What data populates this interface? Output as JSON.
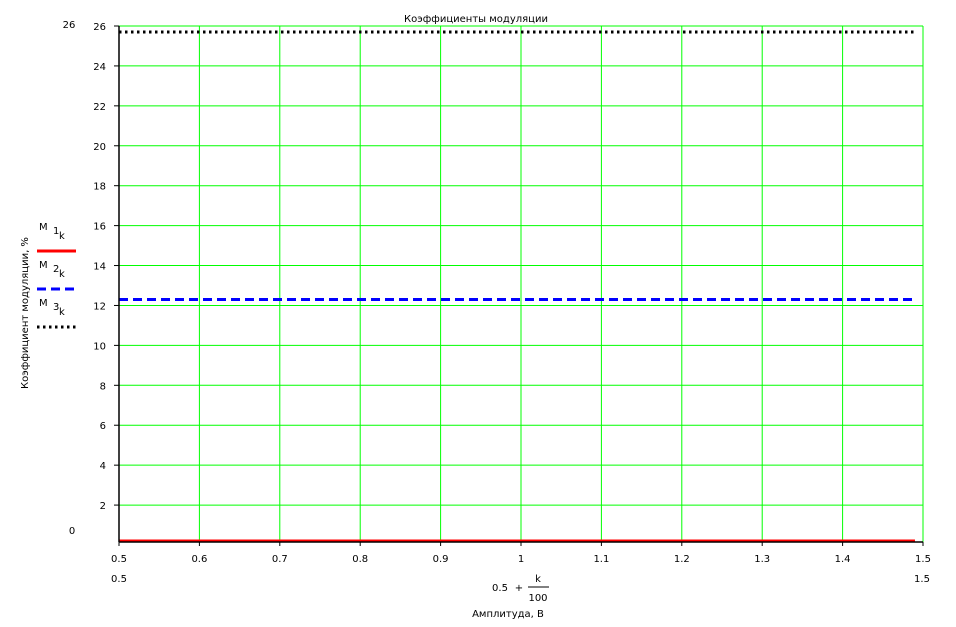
{
  "chart_data": {
    "type": "line",
    "title": "Коэффициенты модуляции",
    "xlabel": "Амплитуда, В",
    "x_expression": {
      "left": "0.5",
      "op": "+",
      "numerator": "k",
      "denominator": "100"
    },
    "ylabel": "Коэффициент модуляции, %",
    "xlim": [
      0.5,
      1.5
    ],
    "ylim": [
      0,
      26
    ],
    "xlim_labels": [
      "0.5",
      "1.5"
    ],
    "ylim_labels": [
      "0",
      "26"
    ],
    "x_ticks": [
      "0.5",
      "0.6",
      "0.7",
      "0.8",
      "0.9",
      "1",
      "1.1",
      "1.2",
      "1.3",
      "1.4",
      "1.5"
    ],
    "y_ticks": [
      "2",
      "4",
      "6",
      "8",
      "10",
      "12",
      "14",
      "16",
      "18",
      "20",
      "22",
      "24",
      "26"
    ],
    "grid": true,
    "grid_color": "#00ff00",
    "legend_placement": "left",
    "series": [
      {
        "name": "M",
        "sub": "1",
        "subk": "k",
        "color": "#ff0000",
        "style": "solid",
        "x": [
          0.5,
          1.49
        ],
        "y": [
          0.2,
          0.2
        ]
      },
      {
        "name": "M",
        "sub": "2",
        "subk": "k",
        "color": "#0000ff",
        "style": "dashed",
        "x": [
          0.5,
          1.49
        ],
        "y": [
          12.3,
          12.3
        ]
      },
      {
        "name": "M",
        "sub": "3",
        "subk": "k",
        "color": "#000000",
        "style": "dotted",
        "x": [
          0.5,
          1.49
        ],
        "y": [
          25.7,
          25.7
        ]
      }
    ]
  }
}
